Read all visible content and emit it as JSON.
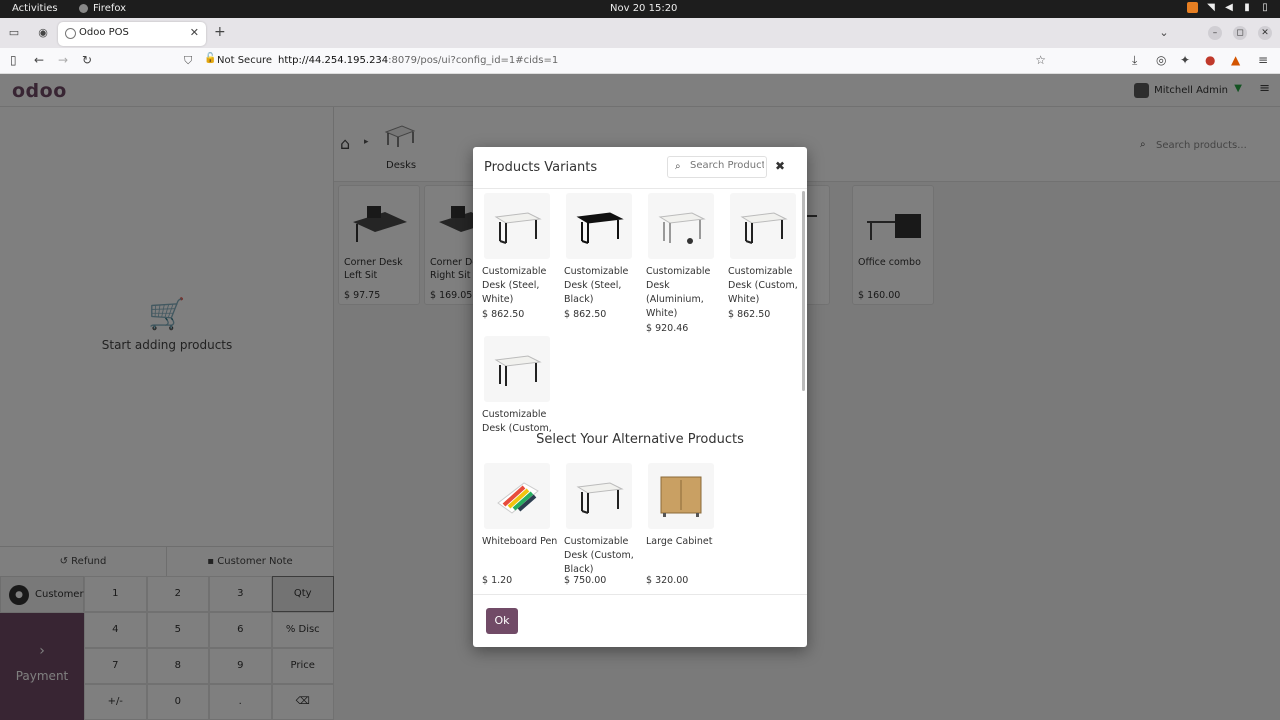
{
  "system_bar": {
    "activities": "Activities",
    "app_name": "Firefox",
    "clock": "Nov 20  15:20"
  },
  "browser": {
    "tab_title": "Odoo POS",
    "security_label": "Not Secure",
    "url_host": "http://44.254.195.234",
    "url_rest": ":8079/pos/ui?config_id=1#cids=1"
  },
  "header": {
    "logo": "odoo",
    "user_name": "Mitchell Admin"
  },
  "order": {
    "empty_message": "Start adding products",
    "refund_label": "Refund",
    "customer_note_label": "Customer Note",
    "customer_label": "Customer",
    "payment_label": "Payment",
    "keys": [
      "1",
      "2",
      "3",
      "Qty",
      "4",
      "5",
      "6",
      "% Disc",
      "7",
      "8",
      "9",
      "Price",
      "+/-",
      "0",
      ".",
      "⌫"
    ]
  },
  "catalog": {
    "category": "Desks",
    "search_placeholder": "Search products...",
    "products": [
      {
        "name": "Corner Desk Left Sit",
        "price": "$ 97.75"
      },
      {
        "name": "Corner Desk Right Sit",
        "price": "$ 169.05"
      },
      {
        "name": "sk",
        "price": "45"
      },
      {
        "name": "Office combo",
        "price": "$ 160.00"
      }
    ]
  },
  "modal": {
    "title": "Products Variants",
    "search_placeholder": "Search Product",
    "variants": [
      {
        "name": "Customizable Desk (Steel, White)",
        "price": "$ 862.50",
        "icon": "white-desk"
      },
      {
        "name": "Customizable Desk (Steel, Black)",
        "price": "$ 862.50",
        "icon": "black-desk"
      },
      {
        "name": "Customizable Desk (Aluminium, White)",
        "price": "$ 920.46",
        "icon": "white-desk"
      },
      {
        "name": "Customizable Desk (Custom, White)",
        "price": "$ 862.50",
        "icon": "white-desk"
      },
      {
        "name": "Customizable Desk (Custom,",
        "price": "",
        "icon": "white-desk"
      }
    ],
    "alternative_title": "Select Your Alternative Products",
    "alternatives": [
      {
        "name": "Whiteboard Pen",
        "price": "$ 1.20",
        "icon": "pens"
      },
      {
        "name": "Customizable Desk (Custom, Black)",
        "price": "$ 750.00",
        "icon": "white-desk"
      },
      {
        "name": "Large Cabinet",
        "price": "$ 320.00",
        "icon": "cabinet"
      }
    ],
    "ok_label": "Ok"
  },
  "colors": {
    "brand": "#714b67",
    "overlay": "rgba(0,0,0,0.5)"
  }
}
